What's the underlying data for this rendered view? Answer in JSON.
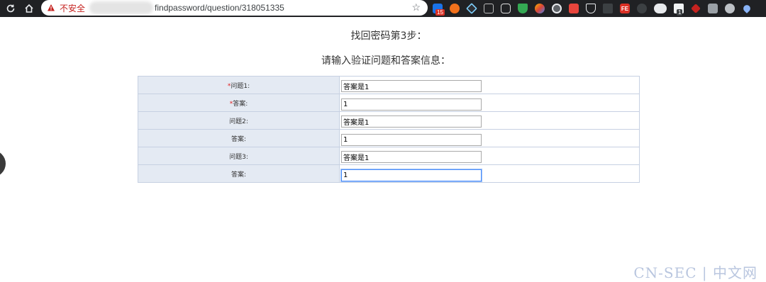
{
  "browser": {
    "insecure_label": "不安全",
    "url_text": "findpassword/question/318051335",
    "extension_badge": "15",
    "extension_fe_label": "FE",
    "extension_count_badge": "1"
  },
  "page": {
    "step_title": "找回密码第3步：",
    "sub_title": "请输入验证问题和答案信息："
  },
  "form": {
    "rows": [
      {
        "required": true,
        "required_mark": "*",
        "label": "问题1:",
        "value": "答案是1"
      },
      {
        "required": true,
        "required_mark": "*",
        "label": "答案:",
        "value": "1"
      },
      {
        "required": false,
        "label": "问题2:",
        "value": "答案是1"
      },
      {
        "required": false,
        "label": "答案:",
        "value": "1"
      },
      {
        "required": false,
        "label": "问题3:",
        "value": "答案是1"
      },
      {
        "required": false,
        "label": "答案:",
        "value": "1",
        "focused": true
      }
    ]
  },
  "watermark": "CN-SEC | 中文网",
  "colors": {
    "label_bg": "#e4eaf3",
    "border": "#c6d0e2",
    "required": "#e02020",
    "watermark": "#b9c6df"
  }
}
